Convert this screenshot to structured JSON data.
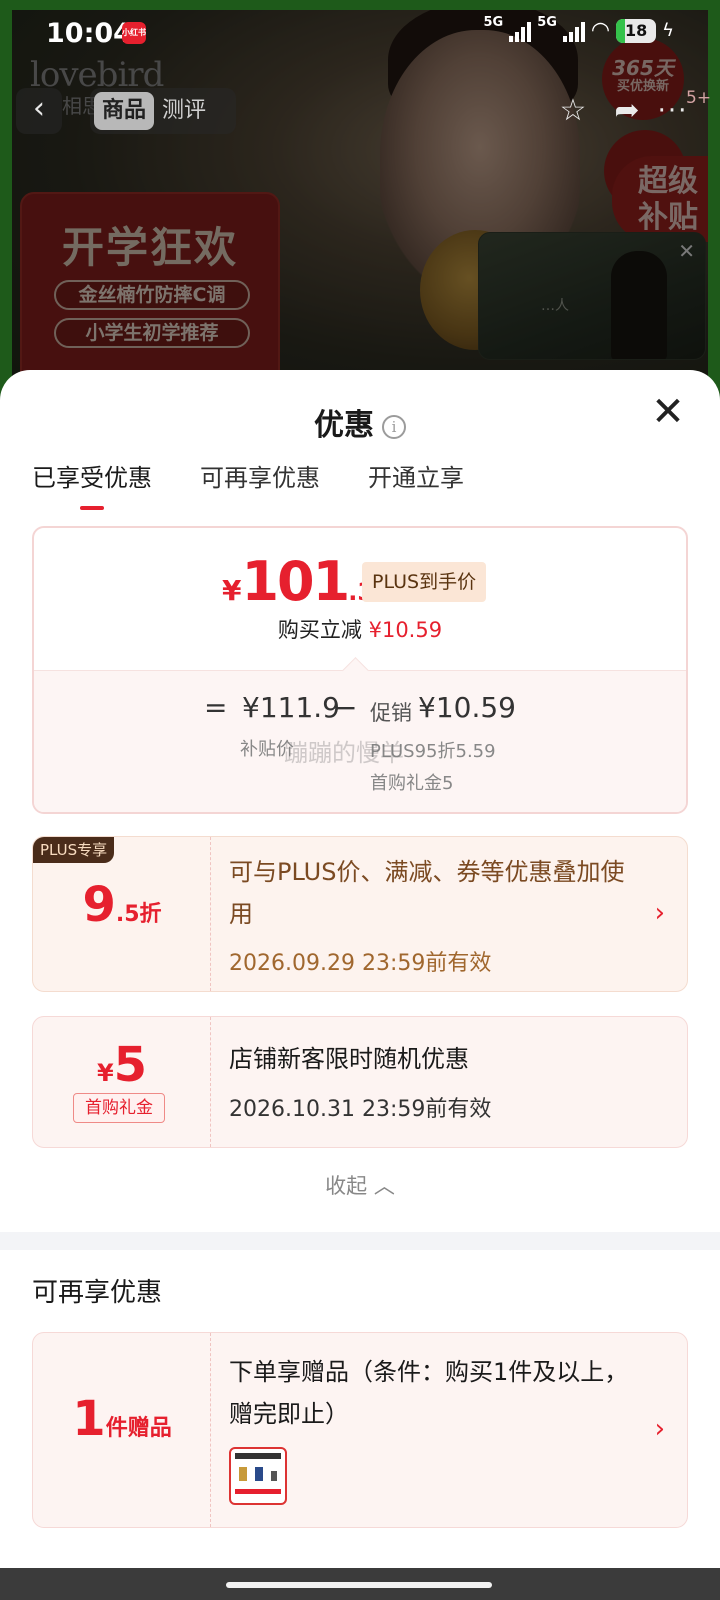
{
  "status_bar": {
    "time": "10:04",
    "app_icon": "小红书",
    "network_1": "5G",
    "network_2": "5G",
    "battery": "18"
  },
  "hero": {
    "brand": "lovebird",
    "brand_sub": "相思",
    "promo_title": "开学狂欢",
    "promo_line_1": "金丝楠竹防摔C调",
    "promo_line_2": "小学生初学推荐",
    "badge_365_big": "365天",
    "badge_365_small": "买优换新",
    "super_badge": "超级补贴",
    "video_caption": "…人",
    "colors": {
      "frame": "#1e5a1a",
      "badge": "#7e1b18"
    }
  },
  "nav": {
    "back_icon": "chevron-left-icon",
    "tabs": [
      "商品",
      "测评"
    ],
    "active_tab": "商品",
    "more_count": "5+"
  },
  "sheet": {
    "title": "优惠",
    "close_icon": "close-icon",
    "tabs": [
      "已享受优惠",
      "可再享优惠",
      "开通立享"
    ],
    "active_tab": "已享受优惠",
    "price": {
      "yen": "¥",
      "integer": "101",
      "decimal": ".31",
      "tag": "PLUS到手价",
      "reduce_label": "购买立减",
      "reduce_value": "¥10.59",
      "eq": "=",
      "base_value": "¥111.9",
      "base_label": "补贴价",
      "minus": "−",
      "promo_label": "促销",
      "promo_value": "¥10.59",
      "promo_line_1": "PLUS95折5.59",
      "promo_line_2": "首购礼金5",
      "watermark": "蹦蹦的慢羊"
    },
    "coupon_plus": {
      "badge": "PLUS专享",
      "discount_big": "9",
      "discount_small": ".5折",
      "desc": "可与PLUS价、满减、券等优惠叠加使用",
      "expire": "2026.09.29 23:59前有效"
    },
    "coupon_newcustomer": {
      "yen": "¥",
      "amount": "5",
      "tag": "首购礼金",
      "desc": "店铺新客限时随机优惠",
      "expire": "2026.10.31 23:59前有效"
    },
    "collapse_label": "收起 ︿",
    "section2_title": "可再享优惠",
    "coupon_gift": {
      "count_big": "1",
      "count_small": "件赠品",
      "desc": "下单享赠品（条件：购买1件及以上，赠完即止）"
    },
    "colors": {
      "accent": "#e6202e",
      "plus_brown": "#4a2c1a"
    }
  }
}
